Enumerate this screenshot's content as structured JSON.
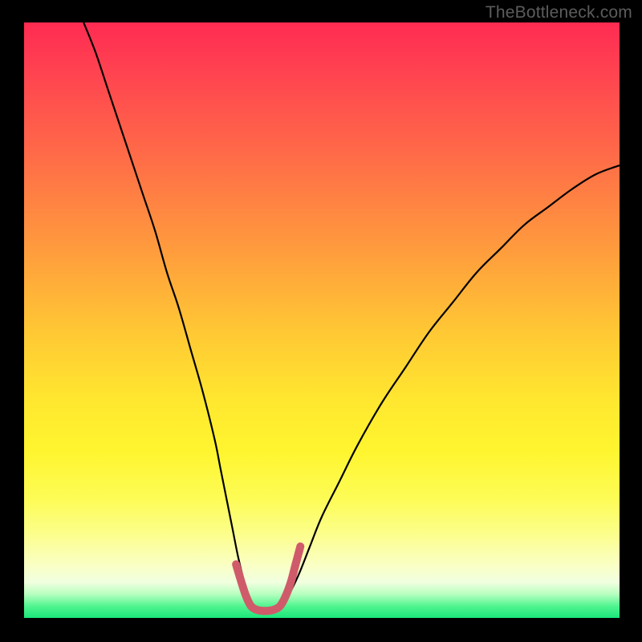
{
  "watermark": "TheBottleneck.com",
  "chart_data": {
    "type": "line",
    "title": "",
    "xlabel": "",
    "ylabel": "",
    "xlim": [
      0,
      100
    ],
    "ylim": [
      0,
      100
    ],
    "series": [
      {
        "name": "bottleneck-curve",
        "color": "#000000",
        "width": 2.2,
        "x": [
          10,
          12,
          14,
          16,
          18,
          20,
          22,
          24,
          26,
          28,
          30,
          32,
          33,
          34,
          35,
          36,
          37,
          38,
          39,
          40,
          41,
          42,
          43,
          44,
          46,
          48,
          50,
          53,
          56,
          60,
          64,
          68,
          72,
          76,
          80,
          84,
          88,
          92,
          96,
          100
        ],
        "y": [
          100,
          95,
          89,
          83,
          77,
          71,
          65,
          58,
          52,
          45,
          38,
          30,
          25,
          20,
          15,
          10,
          6,
          3,
          1.5,
          1,
          1,
          1,
          1.5,
          3,
          7,
          12,
          17,
          23,
          29,
          36,
          42,
          48,
          53,
          58,
          62,
          66,
          69,
          72,
          74.5,
          76
        ]
      },
      {
        "name": "optimal-zone-marker",
        "color": "#cf5b6a",
        "width": 10,
        "linecap": "round",
        "x": [
          35.6,
          36.5,
          37.3,
          38.1,
          39.0,
          40.0,
          41.0,
          42.0,
          43.0,
          43.9,
          44.8,
          45.6,
          46.4
        ],
        "y": [
          9.0,
          6.0,
          3.6,
          2.0,
          1.4,
          1.2,
          1.2,
          1.4,
          2.0,
          3.6,
          6.0,
          9.0,
          12.0
        ]
      }
    ]
  }
}
